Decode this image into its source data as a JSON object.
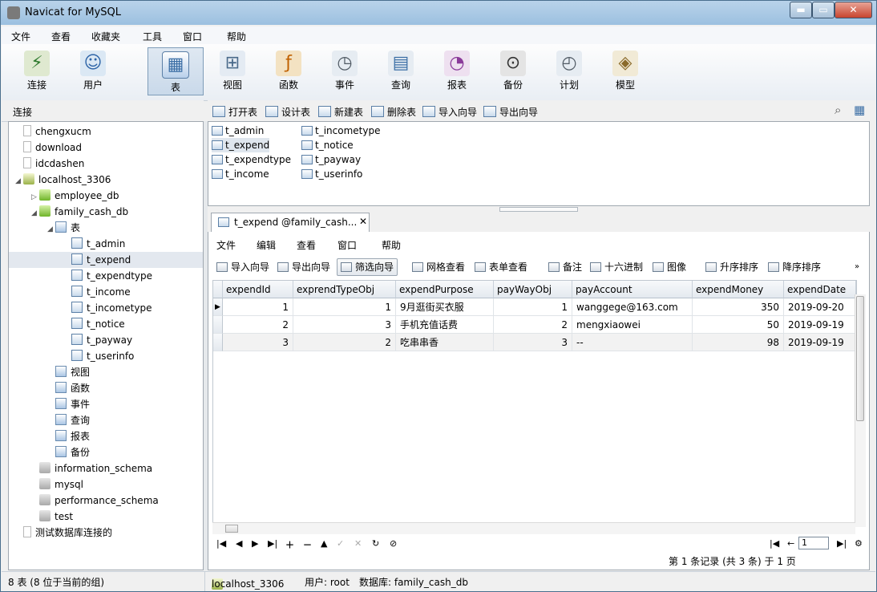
{
  "window": {
    "title": "Navicat for MySQL"
  },
  "menubar": [
    "文件",
    "查看",
    "收藏夹",
    "工具",
    "窗口",
    "帮助"
  ],
  "toolbar": [
    {
      "label": "连接",
      "icon": "connect-icon"
    },
    {
      "label": "用户",
      "icon": "user-icon"
    },
    {
      "label": "表",
      "icon": "table-icon",
      "active": true
    },
    {
      "label": "视图",
      "icon": "view-icon"
    },
    {
      "label": "函数",
      "icon": "function-icon"
    },
    {
      "label": "事件",
      "icon": "event-icon"
    },
    {
      "label": "查询",
      "icon": "query-icon"
    },
    {
      "label": "报表",
      "icon": "report-icon"
    },
    {
      "label": "备份",
      "icon": "backup-icon"
    },
    {
      "label": "计划",
      "icon": "schedule-icon"
    },
    {
      "label": "模型",
      "icon": "model-icon"
    }
  ],
  "connection_header": "连接",
  "object_toolbar": [
    "打开表",
    "设计表",
    "新建表",
    "删除表",
    "导入向导",
    "导出向导"
  ],
  "tree": [
    {
      "label": "chengxucm",
      "icon": "page"
    },
    {
      "label": "download",
      "icon": "page"
    },
    {
      "label": "idcdashen",
      "icon": "page"
    },
    {
      "label": "localhost_3306",
      "icon": "host",
      "arrow": "◢"
    },
    {
      "label": "employee_db",
      "icon": "db-green",
      "arrow": "▷"
    },
    {
      "label": "family_cash_db",
      "icon": "db-green",
      "arrow": "◢"
    },
    {
      "label": "表",
      "icon": "folder",
      "arrow": "◢"
    },
    {
      "label": "t_admin",
      "icon": "table"
    },
    {
      "label": "t_expend",
      "icon": "table",
      "selected": true
    },
    {
      "label": "t_expendtype",
      "icon": "table"
    },
    {
      "label": "t_income",
      "icon": "table"
    },
    {
      "label": "t_incometype",
      "icon": "table"
    },
    {
      "label": "t_notice",
      "icon": "table"
    },
    {
      "label": "t_payway",
      "icon": "table"
    },
    {
      "label": "t_userinfo",
      "icon": "table"
    },
    {
      "label": "视图",
      "icon": "folder"
    },
    {
      "label": "函数",
      "icon": "folder"
    },
    {
      "label": "事件",
      "icon": "folder"
    },
    {
      "label": "查询",
      "icon": "folder"
    },
    {
      "label": "报表",
      "icon": "folder"
    },
    {
      "label": "备份",
      "icon": "folder"
    },
    {
      "label": "information_schema",
      "icon": "db-gray"
    },
    {
      "label": "mysql",
      "icon": "db-gray"
    },
    {
      "label": "performance_schema",
      "icon": "db-gray"
    },
    {
      "label": "test",
      "icon": "db-gray"
    },
    {
      "label": "测试数据库连接的",
      "icon": "page"
    }
  ],
  "objects": {
    "col1": [
      "t_admin",
      "t_expend",
      "t_expendtype",
      "t_income"
    ],
    "col2": [
      "t_incometype",
      "t_notice",
      "t_payway",
      "t_userinfo"
    ]
  },
  "tab": {
    "label": "t_expend @family_cash...",
    "close": "✕"
  },
  "editor_menu": [
    "文件",
    "编辑",
    "查看",
    "窗口",
    "帮助"
  ],
  "editor_toolbar": [
    "导入向导",
    "导出向导",
    "筛选向导",
    "网格查看",
    "表单查看",
    "备注",
    "十六进制",
    "图像",
    "升序排序",
    "降序排序"
  ],
  "grid": {
    "columns": [
      "expendId",
      "exprendTypeObj",
      "expendPurpose",
      "payWayObj",
      "payAccount",
      "expendMoney",
      "expendDate"
    ],
    "rows": [
      [
        "1",
        "1",
        "9月逛街买衣服",
        "1",
        "wanggege@163.com",
        "350",
        "2019-09-20"
      ],
      [
        "2",
        "3",
        "手机充值话费",
        "2",
        "mengxiaowei",
        "50",
        "2019-09-19"
      ],
      [
        "3",
        "2",
        "吃串串香",
        "3",
        "--",
        "98",
        "2019-09-19"
      ]
    ]
  },
  "pager": {
    "page": "1",
    "record_info": "第 1 条记录 (共 3 条) 于 1 页"
  },
  "status": {
    "left": "8 表 (8 位于当前的组)",
    "connection": "localhost_3306",
    "user": "用户: root",
    "database": "数据库: family_cash_db"
  }
}
